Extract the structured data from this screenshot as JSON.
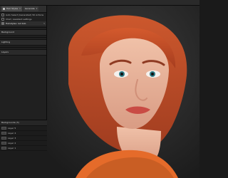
{
  "panel": {
    "tabs": [
      {
        "label": "Hair Styles",
        "active": true
      },
      {
        "label": "Generate",
        "active": false
      }
    ],
    "rows_top": [
      {
        "label": "Auto Select (Generated) 50 Actions",
        "meta": ""
      },
      {
        "label": "Chat / Assistant settings",
        "meta": ""
      },
      {
        "label": "Hairstyles: red bob",
        "meta": "5"
      }
    ],
    "section_1": "Background",
    "section_2": "Lighting",
    "section_3": "Layers",
    "list_title": "Backgrounds (3)",
    "list_items": [
      {
        "label": "Layer 5"
      },
      {
        "label": "Layer 4"
      },
      {
        "label": "Layer 3"
      },
      {
        "label": "Layer 2"
      },
      {
        "label": "Layer 1"
      }
    ]
  },
  "colors": {
    "hair": "#d45a2d",
    "hair_shadow": "#a63d1f",
    "skin": "#f0c1a8",
    "skin_shadow": "#d99c84",
    "lips": "#c94b44",
    "shirt": "#e56b2a",
    "eye": "#2f7c86"
  }
}
